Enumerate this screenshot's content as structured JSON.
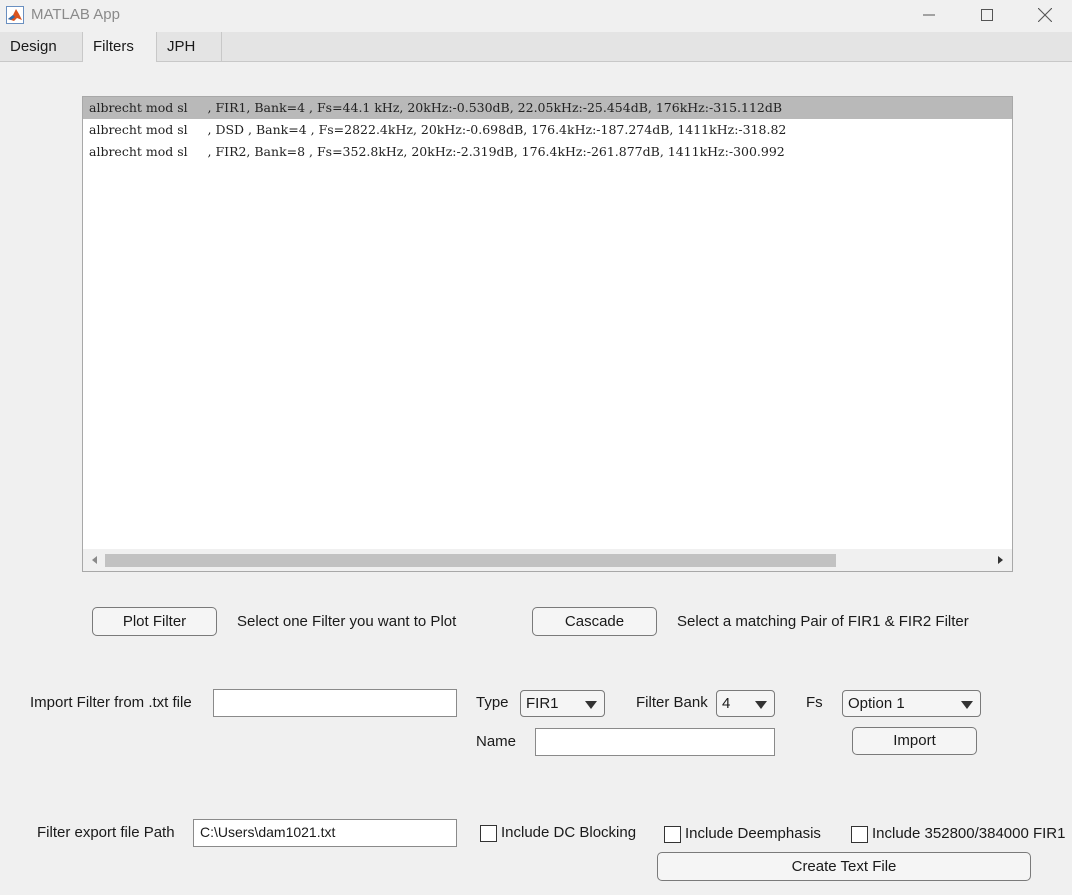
{
  "window": {
    "title": "MATLAB App",
    "app_icon": "matlab-icon",
    "minimize_icon": "minimize-icon",
    "maximize_icon": "maximize-icon",
    "close_icon": "close-icon"
  },
  "tabs": [
    {
      "label": "Design",
      "active": false
    },
    {
      "label": "Filters",
      "active": true
    },
    {
      "label": "JPH",
      "active": false
    }
  ],
  "filter_list": {
    "items": [
      {
        "text": "albrecht mod sl     , FIR1, Bank=4 , Fs=44.1 kHz, 20kHz:-0.530dB, 22.05kHz:-25.454dB, 176kHz:-315.112dB",
        "selected": true
      },
      {
        "text": "albrecht mod sl     , DSD , Bank=4 , Fs=2822.4kHz, 20kHz:-0.698dB, 176.4kHz:-187.274dB, 1411kHz:-318.82",
        "selected": false
      },
      {
        "text": "albrecht mod sl     , FIR2, Bank=8 , Fs=352.8kHz, 20kHz:-2.319dB, 176.4kHz:-261.877dB, 1411kHz:-300.992",
        "selected": false
      }
    ],
    "scroll_left_icon": "scroll-left-arrow-icon",
    "scroll_right_icon": "scroll-right-arrow-icon"
  },
  "plot": {
    "button_label": "Plot Filter",
    "hint": "Select one Filter you want to Plot"
  },
  "cascade": {
    "button_label": "Cascade",
    "hint": "Select a matching Pair of FIR1 & FIR2 Filter"
  },
  "import": {
    "label": "Import Filter from .txt file",
    "file_value": "",
    "type_label": "Type",
    "type_value": "FIR1",
    "bank_label": "Filter Bank",
    "bank_value": "4",
    "fs_label": "Fs",
    "fs_value": "Option 1",
    "name_label": "Name",
    "name_value": "",
    "button_label": "Import"
  },
  "export": {
    "path_label": "Filter export file Path",
    "path_value": "C:\\Users\\dam1021.txt",
    "dc_blocking_label": "Include DC Blocking",
    "dc_blocking_checked": false,
    "deemphasis_label": "Include Deemphasis",
    "deemphasis_checked": false,
    "rate_label": "Include 352800/384000  FIR1",
    "rate_checked": false,
    "create_button_label": "Create Text File"
  }
}
